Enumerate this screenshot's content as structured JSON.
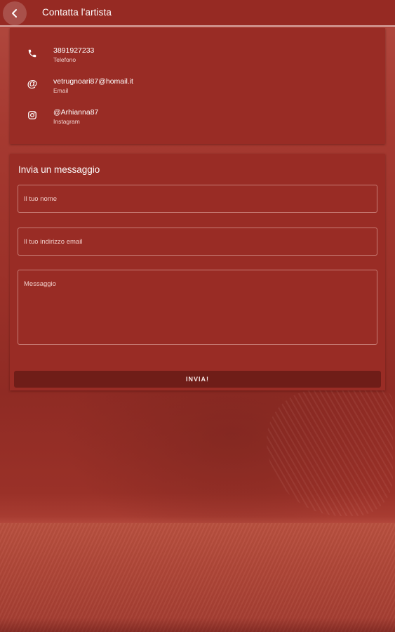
{
  "header": {
    "title": "Contatta l'artista"
  },
  "contacts": [
    {
      "value": "3891927233",
      "label": "Telefono",
      "icon": "phone-icon"
    },
    {
      "value": "vetrugnoari87@homail.it",
      "label": "Email",
      "icon": "at-icon"
    },
    {
      "value": "@Arhianna87",
      "label": "Instagram",
      "icon": "instagram-icon"
    }
  ],
  "form": {
    "title": "Invia un messaggio",
    "name_placeholder": "Il tuo nome",
    "email_placeholder": "Il tuo indirizzo email",
    "message_placeholder": "Messaggio",
    "submit_label": "INVIA!"
  },
  "colors": {
    "primary": "#992c25",
    "topbar": "#962a23",
    "button": "#6f1d18"
  }
}
